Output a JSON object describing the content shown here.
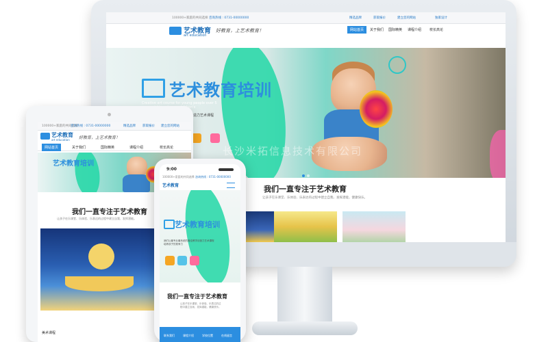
{
  "site": {
    "contact": "100000+家庭的共同选择",
    "hotline": "咨询热线 : 0731-00000000",
    "logo_cn": "艺术教育",
    "logo_en": "art education",
    "slogan": "好教育，上艺术教育！",
    "top_links": [
      "精选品牌",
      "获取报价",
      "建立您的网站",
      "独家设计"
    ]
  },
  "nav": {
    "items": [
      "网站首页",
      "关于我们",
      "国际精英",
      "课程介绍",
      "校长高论"
    ]
  },
  "banner": {
    "title": "艺术教育培训",
    "desc": "Creative art course for young people over 5 years old to enhance children's competitiveness.",
    "desc_cn": "我们以最专业最系统的最佳教学创造力艺术课程",
    "watermark": "长沙米拓信息技术有限公司"
  },
  "section": {
    "title": "我们一直专注于艺术教育",
    "subtitle": "让孩子在乐课堂、乐体验、乐表达的过程中建立自我、发挥潜能，健康快乐。"
  },
  "tablet": {
    "contact": "100000+家庭的共同选择",
    "hotline": "咨询热线 : 0731-00000000",
    "logo_cn": "艺术教育",
    "logo_en": "art education",
    "slogan": "好教育，上艺术教育！",
    "links": [
      "精选品牌",
      "获取报价",
      "建立您的网站"
    ],
    "nav": [
      "网站首页",
      "关于我们",
      "国际精英",
      "课程介绍",
      "校长高论"
    ],
    "banner_title": "艺术教育培训",
    "section_title": "我们一直专注于艺术教育",
    "section_sub": "让孩子在乐课堂、乐体验、乐表达的过程中建立自我、发挥潜能。",
    "caption": "美术课程"
  },
  "phone": {
    "time": "9:00",
    "contact": "100000+家庭的共同选择",
    "hotline": "咨询热线 : 0731-00000000",
    "logo_cn": "艺术教育",
    "banner_title": "艺术教育培训",
    "banner_desc": "我们以最专业最系统的最佳教学创造力艺术课程培养孩子的竞争力",
    "section_title": "我们一直专注于艺术教育",
    "section_sub": "让孩子在乐课堂、乐体验、乐表达的过程中建立自我、发挥潜能，健康快乐。",
    "footer": [
      "联系我们",
      "课程介绍",
      "学校位置",
      "在线留言"
    ]
  },
  "colors": {
    "brand": "#2c8ee0",
    "green": "#22d7a6",
    "pink": "#ff5fb1"
  }
}
